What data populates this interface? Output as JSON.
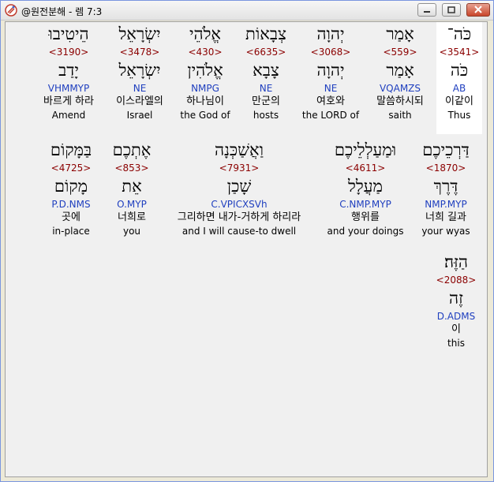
{
  "window": {
    "title": "@원전분해 - 렘 7:3"
  },
  "rows": [
    [
      {
        "heb": "כֹּה־",
        "strong": "<3541>",
        "lex": "כֹּה",
        "morph": "AB",
        "kor": "이같이",
        "eng": "Thus",
        "highlight": true
      },
      {
        "heb": "אָמַר",
        "strong": "<559>",
        "lex": "אָמַר",
        "morph": "VQAMZS",
        "kor": "말씀하시되",
        "eng": "saith"
      },
      {
        "heb": "יְהוָה",
        "strong": "<3068>",
        "lex": "יְהוָה",
        "morph": "NE",
        "kor": "여호와",
        "eng": "the LORD of"
      },
      {
        "heb": "צְבָאוֹת",
        "strong": "<6635>",
        "lex": "צָבָא",
        "morph": "NE",
        "kor": "만군의",
        "eng": "hosts"
      },
      {
        "heb": "אֱלֹהֵי",
        "strong": "<430>",
        "lex": "אֱלֹהִין",
        "morph": "NMPG",
        "kor": "하나님이",
        "eng": "the God of"
      },
      {
        "heb": "יִשְׂרָאֵל",
        "strong": "<3478>",
        "lex": "יִשְׂרָאֵל",
        "morph": "NE",
        "kor": "이스라엘의",
        "eng": "Israel"
      },
      {
        "heb": "הֵיטִיבוּ",
        "strong": "<3190>",
        "lex": "יָדַב",
        "morph": "VHMMYP",
        "kor": "바르게 하라",
        "eng": "Amend"
      }
    ],
    [
      {
        "heb": "דַּרְכֵיכֶם",
        "strong": "<1870>",
        "lex": "דֶּרֶךְ",
        "morph": "NMP.MYP",
        "kor": "너희 길과",
        "eng": "your wyas"
      },
      {
        "heb": "וּמַעַלְלֵיכֶם",
        "strong": "<4611>",
        "lex": "מַעֲלָל",
        "morph": "C.NMP.MYP",
        "kor": "행위를",
        "eng": "and your doings"
      },
      {
        "heb": "וַאֲשַׁכְּנָה",
        "strong": "<7931>",
        "lex": "שָׁכַן",
        "morph": "C.VPICXSVh",
        "kor": "그리하면 내가-거하게 하리라",
        "eng": "and I will cause-to dwell"
      },
      {
        "heb": "אֶתְכֶם",
        "strong": "<853>",
        "lex": "אֵת",
        "morph": "O.MYP",
        "kor": "너희로",
        "eng": "you"
      },
      {
        "heb": "בַּמָּקוֹם",
        "strong": "<4725>",
        "lex": "מָקוֹם",
        "morph": "P.D.NMS",
        "kor": "곳에",
        "eng": "in-place"
      }
    ],
    [
      {
        "heb": "הַזֶּה׃",
        "strong": "<2088>",
        "lex": "זֶה",
        "morph": "D.ADMS",
        "kor": "이",
        "eng": "this"
      }
    ]
  ]
}
